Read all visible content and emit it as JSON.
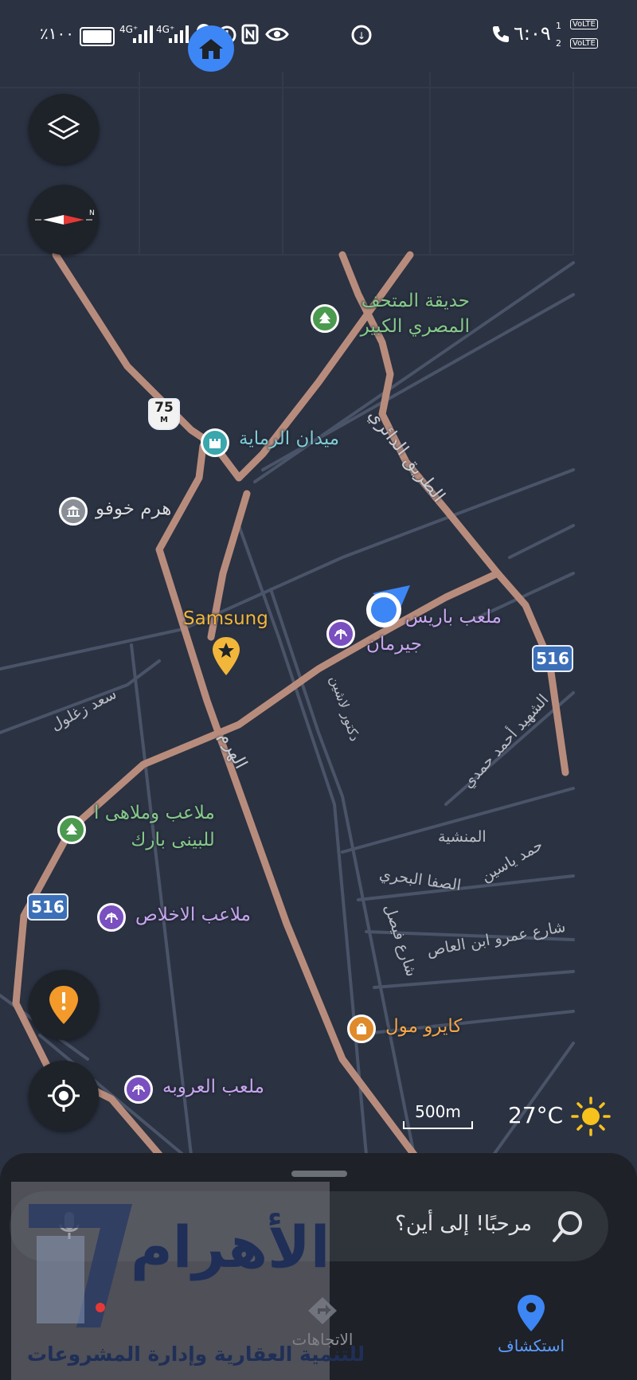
{
  "status_bar": {
    "battery_text": "٪١٠٠",
    "net1": "4G⁺",
    "net2": "4G⁺",
    "time": "٦:٠٩",
    "sim1_badge": "1",
    "sim2_badge": "2",
    "volte1": "VoLTE",
    "volte2": "VoLTE"
  },
  "map": {
    "labels": {
      "museum_park": [
        "حديقة المتحف",
        "المصري الكبير"
      ],
      "shooting_club": "ميدان الرماية",
      "khufu": "هرم خوفو",
      "samsung": "Samsung",
      "paris_stadium": [
        "ملعب باريس",
        "جيرمان"
      ],
      "play_park": [
        "ملاعب وملاهى ا",
        "للبينى بارك"
      ],
      "ikhlas": "ملاعب الاخلاص",
      "cairo_mall": "كايرو مول",
      "orouba": "ملعب العروبه"
    },
    "streets": {
      "ring_road": "الطريق الدائري",
      "haram": "الهرم",
      "saad": "سعد زغلول",
      "dr_lashin": "دكتور لاشين",
      "shaheed": "الشهيد أحمد حمدي",
      "manshia": "المنشية",
      "hamd_yassin": "حمد ياسين",
      "safa": "الصفا البحري",
      "faisal": "شارع فيصل",
      "amr": "شارع عمرو ابن العاص"
    },
    "shields": {
      "m75": "75",
      "m75_sub": "M",
      "r516_a": "516",
      "r516_b": "516"
    },
    "scale": "500m",
    "weather": "27°C"
  },
  "sheet": {
    "search_placeholder": "مرحبًا! إلى أين؟",
    "tabs": [
      "الاتجاهات",
      "استكشاف"
    ]
  },
  "watermark": {
    "title": "الأهرام",
    "subtitle": "للتنمية العقارية وإدارة المشروعات"
  },
  "colors": {
    "map_bg": "#2b3242",
    "major_road": "#b88c7c",
    "minor_road": "#4a5468",
    "accent": "#3d86f5"
  }
}
